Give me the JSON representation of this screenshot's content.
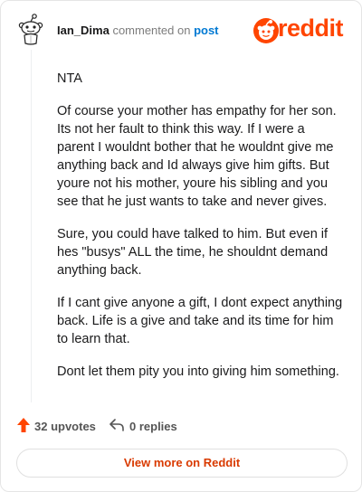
{
  "header": {
    "author": "Ian_Dima",
    "action": "commented on",
    "target": "post",
    "brand": "reddit"
  },
  "comment": {
    "paragraphs": [
      "NTA",
      "Of course your mother has empathy for her son. Its not her fault to think this way. If I were a parent I wouldnt bother that he wouldnt give me anything back and Id always give him gifts. But youre not his mother, youre his sibling and you see that he just wants to take and never gives.",
      "Sure, you could have talked to him. But even if hes \"busys\" ALL the time, he shouldnt demand anything back.",
      "If I cant give anyone a gift, I dont expect anything back. Life is a give and take and its time for him to learn that.",
      "Dont let them pity you into giving him something."
    ]
  },
  "footer": {
    "upvotes": "32 upvotes",
    "replies": "0 replies",
    "cta": "View more on Reddit"
  },
  "colors": {
    "brand": "#ff4500",
    "link": "#0079d3",
    "cta_text": "#d93a00"
  },
  "icons": [
    "avatar-snoo",
    "reddit-logo",
    "upvote-arrow-icon",
    "reply-arrow-icon"
  ]
}
